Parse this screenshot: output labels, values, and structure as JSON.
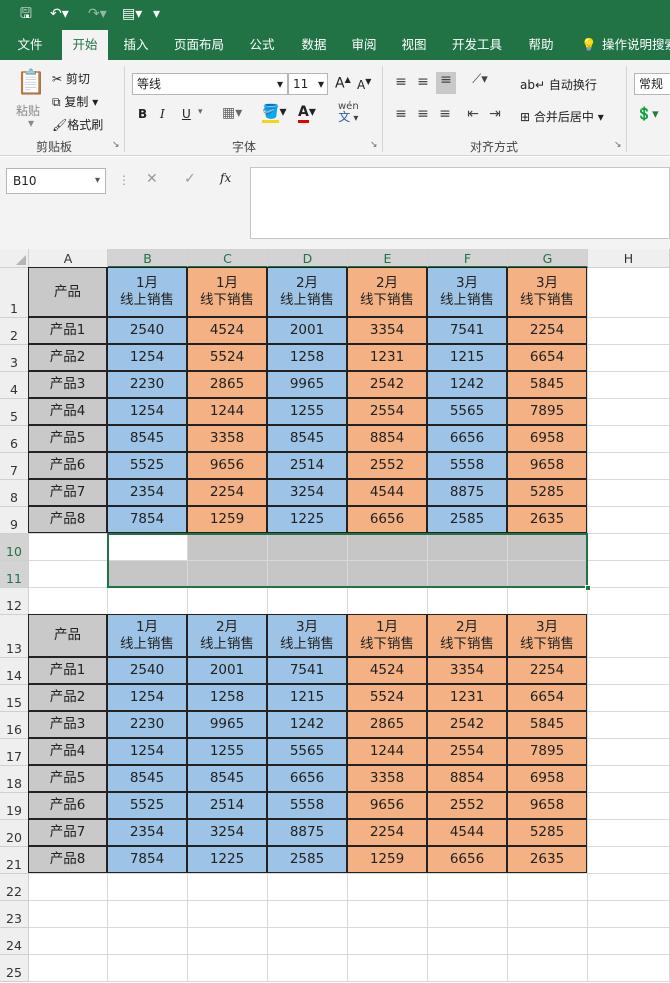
{
  "title_bar": {
    "save_icon": "save-icon",
    "undo_icon": "undo-icon",
    "redo_icon": "redo-icon",
    "form_icon": "form-icon",
    "customize": "▾"
  },
  "tabs": [
    "文件",
    "开始",
    "插入",
    "页面布局",
    "公式",
    "数据",
    "审阅",
    "视图",
    "开发工具",
    "帮助",
    "操作说明搜索"
  ],
  "ribbon": {
    "paste": "粘贴",
    "cut": "剪切",
    "copy": "复制",
    "format_painter": "格式刷",
    "clipboard": "剪贴板",
    "font_name": "等线",
    "font_size": "11",
    "bold": "B",
    "italic": "I",
    "underline": "U",
    "font_group": "字体",
    "wrap_text": "自动换行",
    "merge_center": "合并后居中",
    "align_group": "对齐方式",
    "number_format": "常规",
    "grow_font": "A",
    "shrink_font": "A",
    "font_color": "A",
    "phonetic": "wén",
    "phonetic_char": "文"
  },
  "formula_bar": {
    "name_box": "B10",
    "cancel": "✕",
    "enter": "✓",
    "fx": "fx",
    "value": ""
  },
  "columns": [
    "A",
    "B",
    "C",
    "D",
    "E",
    "F",
    "G",
    "H"
  ],
  "rows": [
    "1",
    "2",
    "3",
    "4",
    "5",
    "6",
    "7",
    "8",
    "9",
    "10",
    "11",
    "12",
    "13",
    "14",
    "15",
    "16",
    "17",
    "18",
    "19",
    "20",
    "21",
    "22",
    "23",
    "24",
    "25"
  ],
  "table1": {
    "corner": "产品",
    "headers": [
      "1月\n线上销售",
      "1月\n线下销售",
      "2月\n线上销售",
      "2月\n线下销售",
      "3月\n线上销售",
      "3月\n线下销售"
    ],
    "rows": [
      [
        "产品1",
        "2540",
        "4524",
        "2001",
        "3354",
        "7541",
        "2254"
      ],
      [
        "产品2",
        "1254",
        "5524",
        "1258",
        "1231",
        "1215",
        "6654"
      ],
      [
        "产品3",
        "2230",
        "2865",
        "9965",
        "2542",
        "1242",
        "5845"
      ],
      [
        "产品4",
        "1254",
        "1244",
        "1255",
        "2554",
        "5565",
        "7895"
      ],
      [
        "产品5",
        "8545",
        "3358",
        "8545",
        "8854",
        "6656",
        "6958"
      ],
      [
        "产品6",
        "5525",
        "9656",
        "2514",
        "2552",
        "5558",
        "9658"
      ],
      [
        "产品7",
        "2354",
        "2254",
        "3254",
        "4544",
        "8875",
        "5285"
      ],
      [
        "产品8",
        "7854",
        "1259",
        "1225",
        "6656",
        "2585",
        "2635"
      ]
    ]
  },
  "table2": {
    "corner": "产品",
    "headers": [
      "1月\n线上销售",
      "2月\n线上销售",
      "3月\n线上销售",
      "1月\n线下销售",
      "2月\n线下销售",
      "3月\n线下销售"
    ],
    "rows": [
      [
        "产品1",
        "2540",
        "2001",
        "7541",
        "4524",
        "3354",
        "2254"
      ],
      [
        "产品2",
        "1254",
        "1258",
        "1215",
        "5524",
        "1231",
        "6654"
      ],
      [
        "产品3",
        "2230",
        "9965",
        "1242",
        "2865",
        "2542",
        "5845"
      ],
      [
        "产品4",
        "1254",
        "1255",
        "5565",
        "1244",
        "2554",
        "7895"
      ],
      [
        "产品5",
        "8545",
        "8545",
        "6656",
        "3358",
        "8854",
        "6958"
      ],
      [
        "产品6",
        "5525",
        "2514",
        "5558",
        "9656",
        "2552",
        "9658"
      ],
      [
        "产品7",
        "2354",
        "3254",
        "8875",
        "2254",
        "4544",
        "5285"
      ],
      [
        "产品8",
        "7854",
        "1225",
        "2585",
        "1259",
        "6656",
        "2635"
      ]
    ]
  },
  "colors": {
    "excel_green": "#217346",
    "online_blue": "#9dc3e6",
    "offline_orange": "#f4b183",
    "label_gray": "#c9c9c9"
  }
}
